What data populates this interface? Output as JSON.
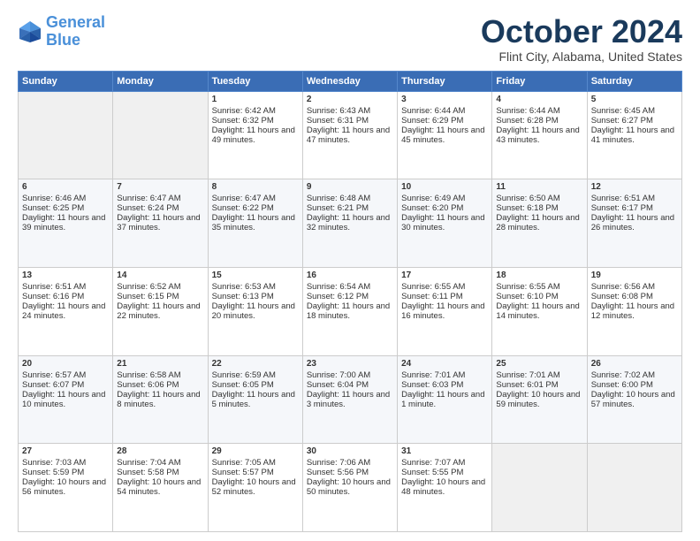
{
  "header": {
    "logo_line1": "General",
    "logo_line2": "Blue",
    "month_title": "October 2024",
    "location": "Flint City, Alabama, United States"
  },
  "weekdays": [
    "Sunday",
    "Monday",
    "Tuesday",
    "Wednesday",
    "Thursday",
    "Friday",
    "Saturday"
  ],
  "weeks": [
    [
      {
        "day": "",
        "sunrise": "",
        "sunset": "",
        "daylight": "",
        "empty": true
      },
      {
        "day": "",
        "sunrise": "",
        "sunset": "",
        "daylight": "",
        "empty": true
      },
      {
        "day": "1",
        "sunrise": "Sunrise: 6:42 AM",
        "sunset": "Sunset: 6:32 PM",
        "daylight": "Daylight: 11 hours and 49 minutes."
      },
      {
        "day": "2",
        "sunrise": "Sunrise: 6:43 AM",
        "sunset": "Sunset: 6:31 PM",
        "daylight": "Daylight: 11 hours and 47 minutes."
      },
      {
        "day": "3",
        "sunrise": "Sunrise: 6:44 AM",
        "sunset": "Sunset: 6:29 PM",
        "daylight": "Daylight: 11 hours and 45 minutes."
      },
      {
        "day": "4",
        "sunrise": "Sunrise: 6:44 AM",
        "sunset": "Sunset: 6:28 PM",
        "daylight": "Daylight: 11 hours and 43 minutes."
      },
      {
        "day": "5",
        "sunrise": "Sunrise: 6:45 AM",
        "sunset": "Sunset: 6:27 PM",
        "daylight": "Daylight: 11 hours and 41 minutes."
      }
    ],
    [
      {
        "day": "6",
        "sunrise": "Sunrise: 6:46 AM",
        "sunset": "Sunset: 6:25 PM",
        "daylight": "Daylight: 11 hours and 39 minutes."
      },
      {
        "day": "7",
        "sunrise": "Sunrise: 6:47 AM",
        "sunset": "Sunset: 6:24 PM",
        "daylight": "Daylight: 11 hours and 37 minutes."
      },
      {
        "day": "8",
        "sunrise": "Sunrise: 6:47 AM",
        "sunset": "Sunset: 6:22 PM",
        "daylight": "Daylight: 11 hours and 35 minutes."
      },
      {
        "day": "9",
        "sunrise": "Sunrise: 6:48 AM",
        "sunset": "Sunset: 6:21 PM",
        "daylight": "Daylight: 11 hours and 32 minutes."
      },
      {
        "day": "10",
        "sunrise": "Sunrise: 6:49 AM",
        "sunset": "Sunset: 6:20 PM",
        "daylight": "Daylight: 11 hours and 30 minutes."
      },
      {
        "day": "11",
        "sunrise": "Sunrise: 6:50 AM",
        "sunset": "Sunset: 6:18 PM",
        "daylight": "Daylight: 11 hours and 28 minutes."
      },
      {
        "day": "12",
        "sunrise": "Sunrise: 6:51 AM",
        "sunset": "Sunset: 6:17 PM",
        "daylight": "Daylight: 11 hours and 26 minutes."
      }
    ],
    [
      {
        "day": "13",
        "sunrise": "Sunrise: 6:51 AM",
        "sunset": "Sunset: 6:16 PM",
        "daylight": "Daylight: 11 hours and 24 minutes."
      },
      {
        "day": "14",
        "sunrise": "Sunrise: 6:52 AM",
        "sunset": "Sunset: 6:15 PM",
        "daylight": "Daylight: 11 hours and 22 minutes."
      },
      {
        "day": "15",
        "sunrise": "Sunrise: 6:53 AM",
        "sunset": "Sunset: 6:13 PM",
        "daylight": "Daylight: 11 hours and 20 minutes."
      },
      {
        "day": "16",
        "sunrise": "Sunrise: 6:54 AM",
        "sunset": "Sunset: 6:12 PM",
        "daylight": "Daylight: 11 hours and 18 minutes."
      },
      {
        "day": "17",
        "sunrise": "Sunrise: 6:55 AM",
        "sunset": "Sunset: 6:11 PM",
        "daylight": "Daylight: 11 hours and 16 minutes."
      },
      {
        "day": "18",
        "sunrise": "Sunrise: 6:55 AM",
        "sunset": "Sunset: 6:10 PM",
        "daylight": "Daylight: 11 hours and 14 minutes."
      },
      {
        "day": "19",
        "sunrise": "Sunrise: 6:56 AM",
        "sunset": "Sunset: 6:08 PM",
        "daylight": "Daylight: 11 hours and 12 minutes."
      }
    ],
    [
      {
        "day": "20",
        "sunrise": "Sunrise: 6:57 AM",
        "sunset": "Sunset: 6:07 PM",
        "daylight": "Daylight: 11 hours and 10 minutes."
      },
      {
        "day": "21",
        "sunrise": "Sunrise: 6:58 AM",
        "sunset": "Sunset: 6:06 PM",
        "daylight": "Daylight: 11 hours and 8 minutes."
      },
      {
        "day": "22",
        "sunrise": "Sunrise: 6:59 AM",
        "sunset": "Sunset: 6:05 PM",
        "daylight": "Daylight: 11 hours and 5 minutes."
      },
      {
        "day": "23",
        "sunrise": "Sunrise: 7:00 AM",
        "sunset": "Sunset: 6:04 PM",
        "daylight": "Daylight: 11 hours and 3 minutes."
      },
      {
        "day": "24",
        "sunrise": "Sunrise: 7:01 AM",
        "sunset": "Sunset: 6:03 PM",
        "daylight": "Daylight: 11 hours and 1 minute."
      },
      {
        "day": "25",
        "sunrise": "Sunrise: 7:01 AM",
        "sunset": "Sunset: 6:01 PM",
        "daylight": "Daylight: 10 hours and 59 minutes."
      },
      {
        "day": "26",
        "sunrise": "Sunrise: 7:02 AM",
        "sunset": "Sunset: 6:00 PM",
        "daylight": "Daylight: 10 hours and 57 minutes."
      }
    ],
    [
      {
        "day": "27",
        "sunrise": "Sunrise: 7:03 AM",
        "sunset": "Sunset: 5:59 PM",
        "daylight": "Daylight: 10 hours and 56 minutes."
      },
      {
        "day": "28",
        "sunrise": "Sunrise: 7:04 AM",
        "sunset": "Sunset: 5:58 PM",
        "daylight": "Daylight: 10 hours and 54 minutes."
      },
      {
        "day": "29",
        "sunrise": "Sunrise: 7:05 AM",
        "sunset": "Sunset: 5:57 PM",
        "daylight": "Daylight: 10 hours and 52 minutes."
      },
      {
        "day": "30",
        "sunrise": "Sunrise: 7:06 AM",
        "sunset": "Sunset: 5:56 PM",
        "daylight": "Daylight: 10 hours and 50 minutes."
      },
      {
        "day": "31",
        "sunrise": "Sunrise: 7:07 AM",
        "sunset": "Sunset: 5:55 PM",
        "daylight": "Daylight: 10 hours and 48 minutes."
      },
      {
        "day": "",
        "sunrise": "",
        "sunset": "",
        "daylight": "",
        "empty": true
      },
      {
        "day": "",
        "sunrise": "",
        "sunset": "",
        "daylight": "",
        "empty": true
      }
    ]
  ]
}
